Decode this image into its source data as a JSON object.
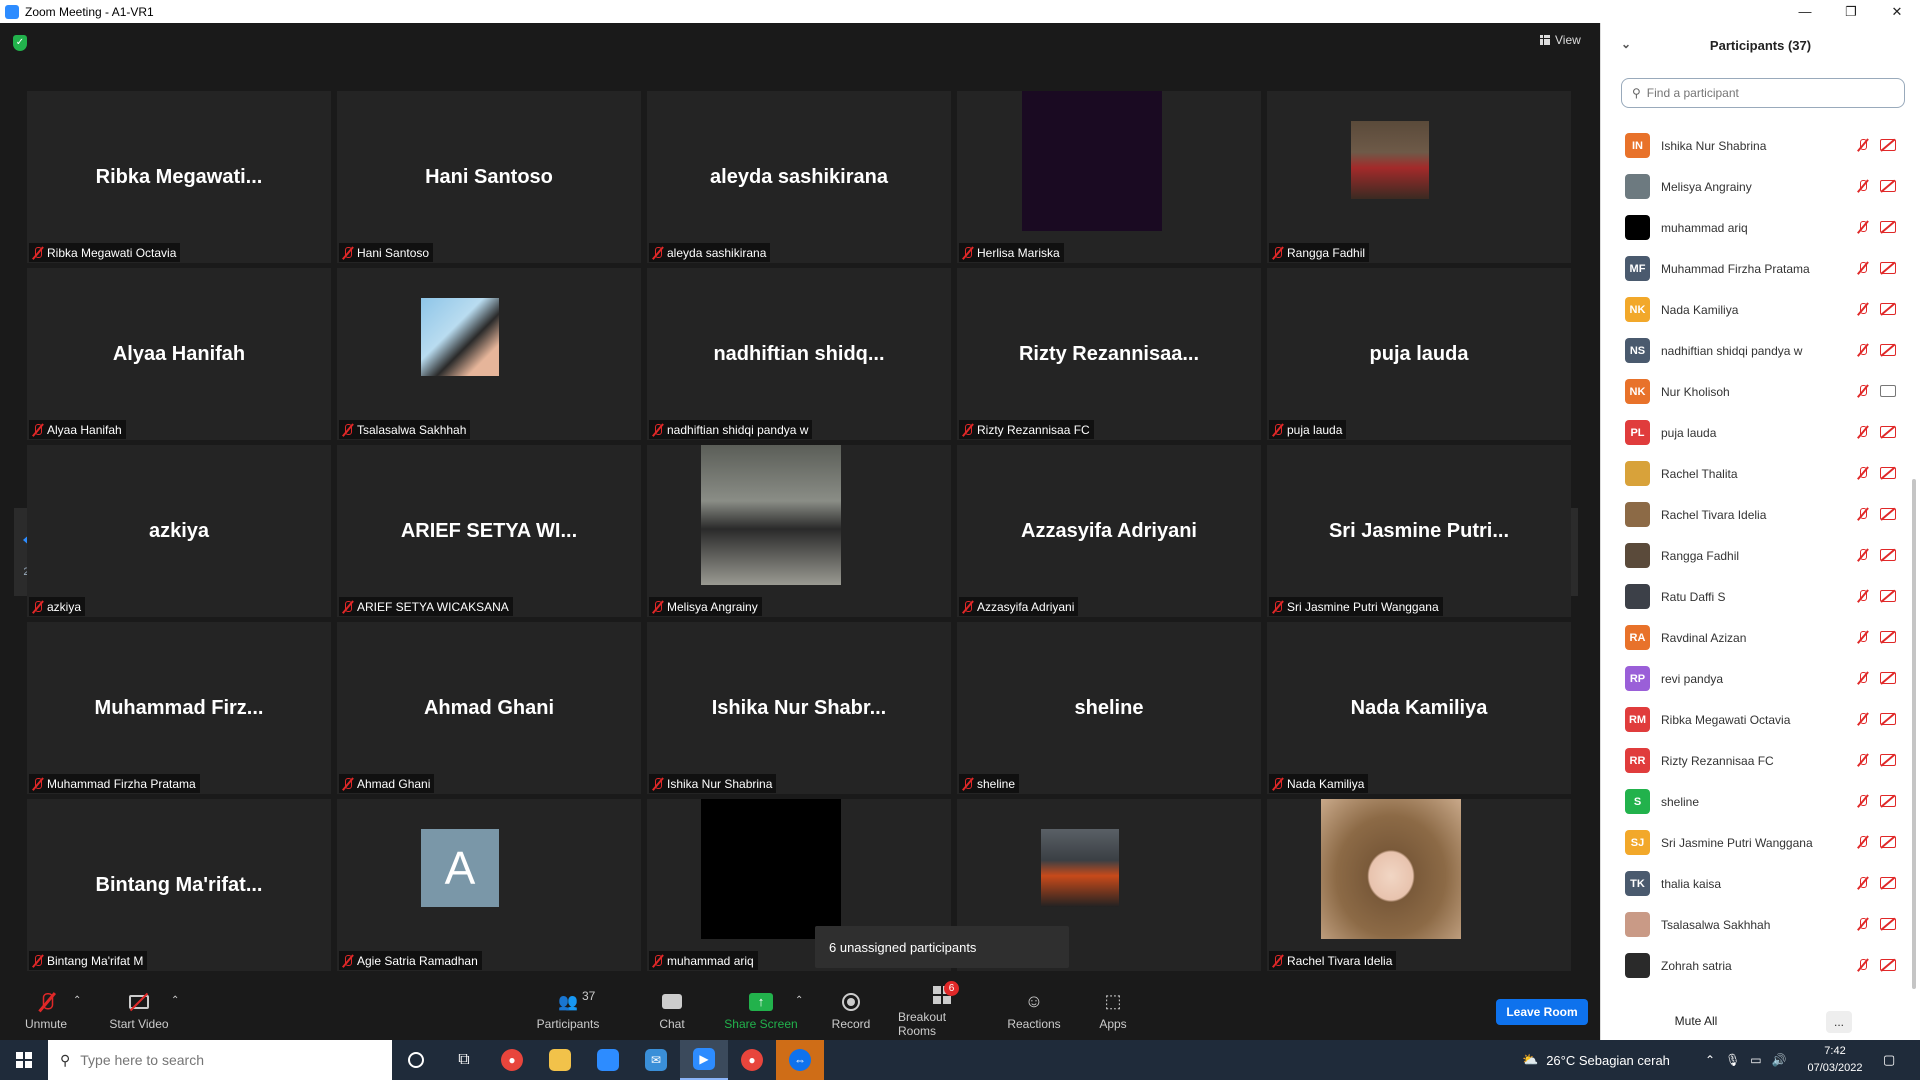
{
  "window": {
    "title": "Zoom Meeting - A1-VR1",
    "controls": [
      "—",
      "❐",
      "✕"
    ]
  },
  "meeting": {
    "view_label": "View",
    "page_indicator": "2/2",
    "toast": "6 unassigned participants",
    "tiles": [
      {
        "big": "Ribka  Megawati...",
        "label": "Ribka Megawati Octavia",
        "photo": ""
      },
      {
        "big": "Hani Santoso",
        "label": "Hani Santoso",
        "photo": ""
      },
      {
        "big": "aleyda sashikirana",
        "label": "aleyda sashikirana",
        "photo": ""
      },
      {
        "big": "",
        "label": "Herlisa Mariska",
        "photo": "ph-dark"
      },
      {
        "big": "",
        "label": "Rangga Fadhil",
        "photo": "ph-person1"
      },
      {
        "big": "Alyaa Hanifah",
        "label": "Alyaa Hanifah",
        "photo": ""
      },
      {
        "big": "",
        "label": "Tsalasalwa Sakhhah",
        "photo": "ph-person2"
      },
      {
        "big": "nadhiftian  shidq...",
        "label": "nadhiftian shidqi pandya w",
        "photo": ""
      },
      {
        "big": "Rizty  Rezannisaa...",
        "label": "Rizty Rezannisaa FC",
        "photo": ""
      },
      {
        "big": "puja lauda",
        "label": "puja lauda",
        "photo": ""
      },
      {
        "big": "azkiya",
        "label": "azkiya",
        "photo": ""
      },
      {
        "big": "ARIEF  SETYA  WI...",
        "label": "ARIEF SETYA WICAKSANA",
        "photo": ""
      },
      {
        "big": "",
        "label": "Melisya Angrainy",
        "photo": "ph-street"
      },
      {
        "big": "Azzasyifa Adriyani",
        "label": "Azzasyifa Adriyani",
        "photo": ""
      },
      {
        "big": "Sri Jasmine Putri...",
        "label": "Sri Jasmine Putri Wanggana",
        "photo": ""
      },
      {
        "big": "Muhammad  Firz...",
        "label": "Muhammad Firzha Pratama",
        "photo": ""
      },
      {
        "big": "Ahmad Ghani",
        "label": "Ahmad Ghani",
        "photo": ""
      },
      {
        "big": "Ishika Nur Shabr...",
        "label": "Ishika Nur Shabrina",
        "photo": ""
      },
      {
        "big": "sheline",
        "label": "sheline",
        "photo": ""
      },
      {
        "big": "Nada Kamiliya",
        "label": "Nada Kamiliya",
        "photo": ""
      },
      {
        "big": "Bintang  Ma'rifat...",
        "label": "Bintang Ma'rifat M",
        "photo": ""
      },
      {
        "big": "",
        "label": "Agie Satria Ramadhan",
        "photo": "ph-avatarA",
        "avatar_letter": "A"
      },
      {
        "big": "",
        "label": "muhammad ariq",
        "photo": "ph-black"
      },
      {
        "big": "",
        "label": "",
        "photo": "ph-bike"
      },
      {
        "big": "",
        "label": "Rachel Tivara Idelia",
        "photo": "ph-hijab"
      }
    ]
  },
  "toolbar": {
    "unmute": "Unmute",
    "start_video": "Start Video",
    "participants": "Participants",
    "participants_count": "37",
    "chat": "Chat",
    "share_screen": "Share Screen",
    "record": "Record",
    "breakout_rooms": "Breakout Rooms",
    "breakout_badge": "6",
    "reactions": "Reactions",
    "apps": "Apps",
    "leave_room": "Leave Room"
  },
  "panel": {
    "title": "Participants (37)",
    "search_placeholder": "Find a participant",
    "mute_all": "Mute All",
    "more": "...",
    "participants": [
      {
        "name": "Ishika Nur Shabrina",
        "initials": "IN",
        "color": "#e8722a",
        "cam_on": false
      },
      {
        "name": "Melisya Angrainy",
        "initials": "",
        "color": "#6d7a80",
        "cam_on": false
      },
      {
        "name": "muhammad ariq",
        "initials": "",
        "color": "#000000",
        "cam_on": false
      },
      {
        "name": "Muhammad Firzha Pratama",
        "initials": "MF",
        "color": "#4a5a6e",
        "cam_on": false
      },
      {
        "name": "Nada Kamiliya",
        "initials": "NK",
        "color": "#f2a82a",
        "cam_on": false
      },
      {
        "name": "nadhiftian shidqi pandya w",
        "initials": "NS",
        "color": "#4a5a6e",
        "cam_on": false
      },
      {
        "name": "Nur Kholisoh",
        "initials": "NK",
        "color": "#e8722a",
        "cam_on": true
      },
      {
        "name": "puja lauda",
        "initials": "PL",
        "color": "#e03c3c",
        "cam_on": false
      },
      {
        "name": "Rachel Thalita",
        "initials": "",
        "color": "#d8a23a",
        "cam_on": false
      },
      {
        "name": "Rachel Tivara Idelia",
        "initials": "",
        "color": "#8c6a46",
        "cam_on": false
      },
      {
        "name": "Rangga Fadhil",
        "initials": "",
        "color": "#5a4a3a",
        "cam_on": false
      },
      {
        "name": "Ratu Daffi S",
        "initials": "",
        "color": "#3c4048",
        "cam_on": false
      },
      {
        "name": "Ravdinal Azizan",
        "initials": "RA",
        "color": "#e8722a",
        "cam_on": false
      },
      {
        "name": "revi pandya",
        "initials": "RP",
        "color": "#9a5fd8",
        "cam_on": false
      },
      {
        "name": "Ribka Megawati Octavia",
        "initials": "RM",
        "color": "#e03c3c",
        "cam_on": false
      },
      {
        "name": "Rizty Rezannisaa FC",
        "initials": "RR",
        "color": "#e03c3c",
        "cam_on": false
      },
      {
        "name": "sheline",
        "initials": "S",
        "color": "#22b24c",
        "cam_on": false
      },
      {
        "name": "Sri Jasmine Putri Wanggana",
        "initials": "SJ",
        "color": "#f2a82a",
        "cam_on": false
      },
      {
        "name": "thalia kaisa",
        "initials": "TK",
        "color": "#4a5a6e",
        "cam_on": false
      },
      {
        "name": "Tsalasalwa Sakhhah",
        "initials": "",
        "color": "#c99a86",
        "cam_on": false
      },
      {
        "name": "Zohrah satria",
        "initials": "",
        "color": "#2a2a2a",
        "cam_on": false
      }
    ]
  },
  "taskbar": {
    "search_placeholder": "Type here to search",
    "weather": "26°C  Sebagian cerah",
    "time": "7:42",
    "date": "07/03/2022"
  }
}
